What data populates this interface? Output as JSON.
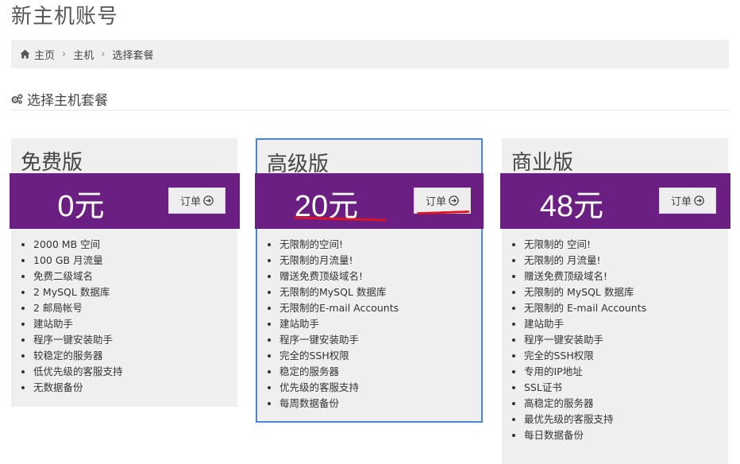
{
  "page": {
    "title": "新主机账号"
  },
  "breadcrumb": {
    "items": [
      "主页",
      "主机",
      "选择套餐"
    ],
    "separator": "›"
  },
  "section": {
    "title": "选择主机套餐"
  },
  "colors": {
    "band": "#6c1f82",
    "highlight_border": "#4a86d8",
    "annotation": "#e0141e"
  },
  "plans": [
    {
      "name": "免费版",
      "price": "0元",
      "order_label": "订单",
      "features": [
        "2000 MB 空间",
        "100 GB 月流量",
        "免费二级域名",
        "2 MySQL 数据库",
        "2 邮局帐号",
        "建站助手",
        "程序一键安装助手",
        "较稳定的服务器",
        "低优先级的客服支持",
        "无数据备份"
      ]
    },
    {
      "name": "高级版",
      "price": "20元",
      "order_label": "订单",
      "features": [
        "无限制的空间!",
        "无限制的月流量!",
        "赠送免费顶级域名!",
        "无限制的MySQL 数据库",
        "无限制的E-mail Accounts",
        "建站助手",
        "程序一键安装助手",
        "完全的SSH权限",
        "稳定的服务器",
        "优先级的客服支持",
        "每周数据备份"
      ]
    },
    {
      "name": "商业版",
      "price": "48元",
      "order_label": "订单",
      "features": [
        "无限制的 空间!",
        "无限制的 月流量!",
        "赠送免费顶级域名!",
        "无限制的 MySQL 数据库",
        "无限制的 E-mail Accounts",
        "建站助手",
        "程序一键安装助手",
        "完全的SSH权限",
        "专用的IP地址",
        "SSL证书",
        "高稳定的服务器",
        "最优先级的客服支持",
        "每日数据备份"
      ]
    }
  ]
}
